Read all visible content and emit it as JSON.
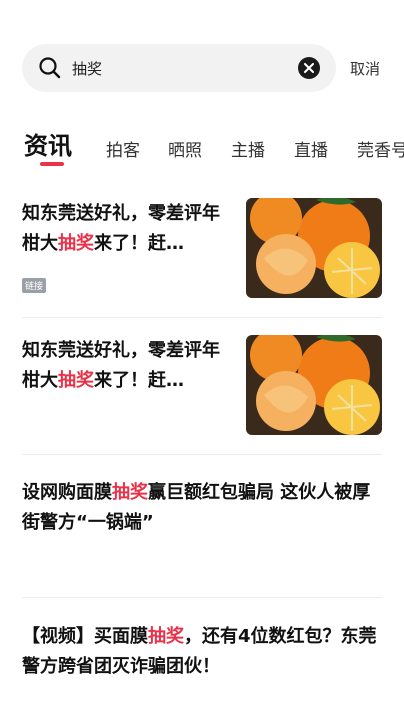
{
  "search": {
    "query": "抽奖",
    "cancel_label": "取消"
  },
  "tabs": [
    {
      "label": "资讯",
      "active": true
    },
    {
      "label": "拍客"
    },
    {
      "label": "晒照"
    },
    {
      "label": "主播"
    },
    {
      "label": "直播"
    },
    {
      "label": "莞香号"
    }
  ],
  "accent_color": "#e8334a",
  "articles": [
    {
      "title_before": "知东莞送好礼，零差评年柑大",
      "title_highlight": "抽奖",
      "title_after": "来了！赶…",
      "tag": "链接",
      "thumbnail": "orange-image"
    },
    {
      "title_before": "知东莞送好礼，零差评年柑大",
      "title_highlight": "抽奖",
      "title_after": "来了！赶…",
      "thumbnail": "orange-image"
    },
    {
      "title_before": "设网购面膜",
      "title_highlight": "抽奖",
      "title_after": "赢巨额红包骗局 这伙人被厚街警方“一锅端”"
    },
    {
      "title_before": "【视频】买面膜",
      "title_highlight": "抽奖",
      "title_after": "，还有4位数红包？东莞警方跨省团灭诈骗团伙！"
    }
  ]
}
